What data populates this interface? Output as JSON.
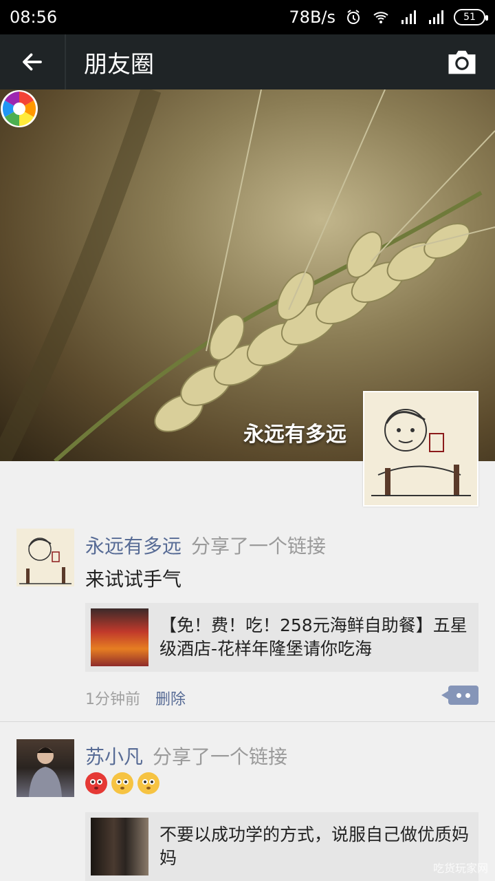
{
  "status_bar": {
    "time": "08:56",
    "speed": "78B/s",
    "battery": "51"
  },
  "nav": {
    "title": "朋友圈",
    "back_icon": "arrow-left-icon",
    "camera_icon": "camera-icon"
  },
  "cover": {
    "name": "永远有多远"
  },
  "posts": [
    {
      "name": "永远有多远",
      "action": "分享了一个链接",
      "text": "来试试手气",
      "link_title": "【免！费！吃！258元海鲜自助餐】五星级酒店-花样年隆堡请你吃海",
      "time": "1分钟前",
      "delete": "删除"
    },
    {
      "name": "苏小凡",
      "action": "分享了一个链接",
      "text": "",
      "link_title": "不要以成功学的方式，说服自己做优质妈妈"
    }
  ],
  "watermark": "吃货玩家网"
}
